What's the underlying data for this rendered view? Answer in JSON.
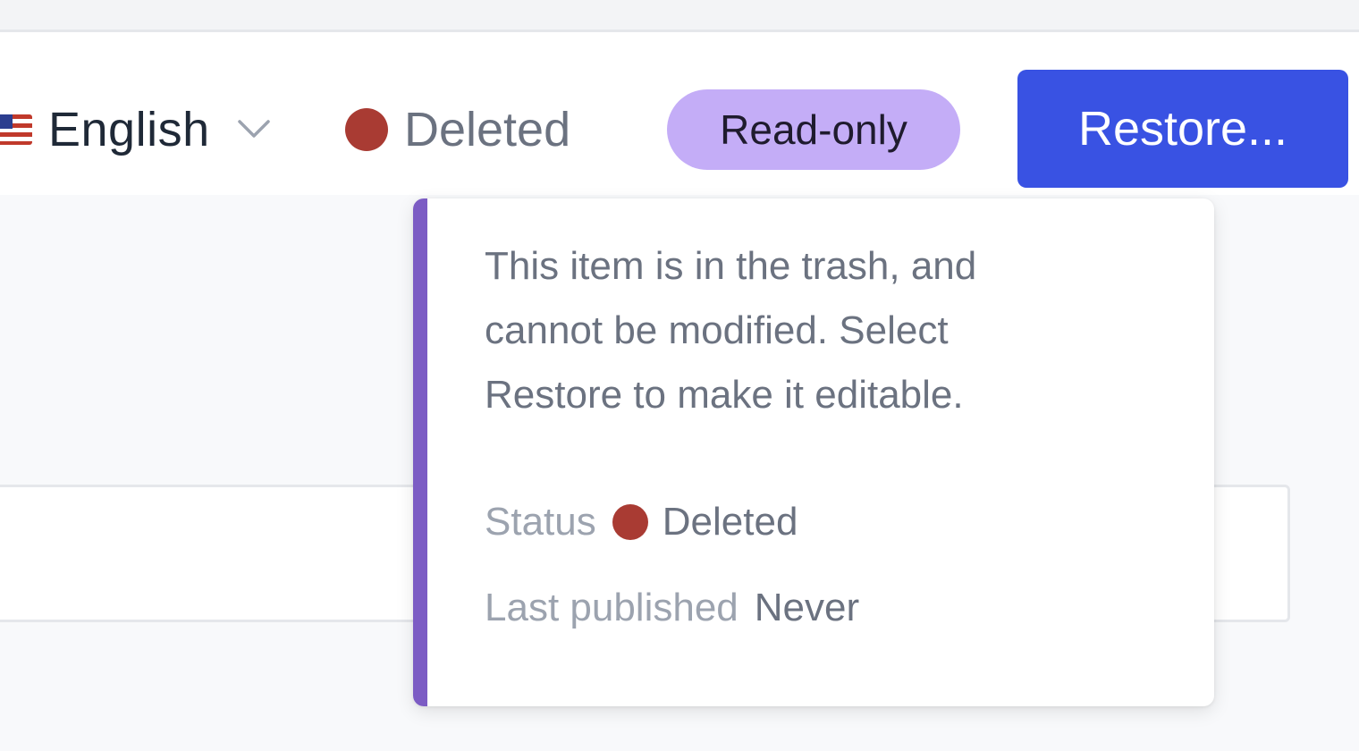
{
  "header": {
    "locale": {
      "flag_icon": "us-flag-icon",
      "label": "English"
    },
    "status": {
      "label": "Deleted",
      "color": "#a93b33"
    },
    "badge": {
      "label": "Read-only",
      "color": "#c4adf7"
    },
    "restore_button": {
      "label": "Restore...",
      "color": "#3952e3"
    }
  },
  "popover": {
    "message": "This item is in the trash, and cannot be modified. Select Restore to make it editable.",
    "accent_color": "#7c5cc4",
    "status_key": "Status",
    "status_value": "Deleted",
    "last_published_key": "Last published",
    "last_published_value": "Never"
  }
}
